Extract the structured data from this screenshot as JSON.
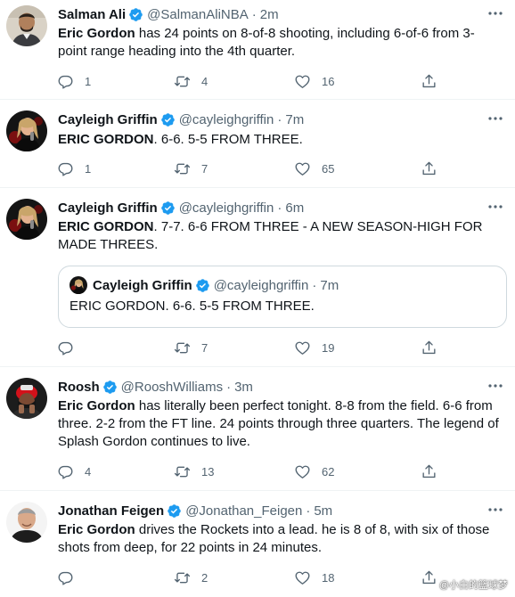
{
  "tweets": [
    {
      "name": "Salman Ali",
      "handle": "@SalmanAliNBA",
      "time": "2m",
      "text_bold": "Eric Gordon",
      "text_rest": " has 24 points on 8-of-8 shooting, including 6-of-6 from 3-point range heading into the 4th quarter.",
      "replies": "1",
      "retweets": "4",
      "likes": "16"
    },
    {
      "name": "Cayleigh Griffin",
      "handle": "@cayleighgriffin",
      "time": "7m",
      "text_bold": "ERIC GORDON",
      "text_rest": ". 6-6. 5-5 FROM THREE.",
      "replies": "1",
      "retweets": "7",
      "likes": "65"
    },
    {
      "name": "Cayleigh Griffin",
      "handle": "@cayleighgriffin",
      "time": "6m",
      "text_bold": "ERIC GORDON",
      "text_rest": ". 7-7. 6-6 FROM THREE - A NEW SEASON-HIGH FOR MADE THREES.",
      "replies": "",
      "retweets": "7",
      "likes": "19",
      "quote": {
        "name": "Cayleigh Griffin",
        "handle": "@cayleighgriffin",
        "time": "7m",
        "text": "ERIC GORDON. 6-6. 5-5 FROM THREE."
      }
    },
    {
      "name": "Roosh",
      "handle": "@RooshWilliams",
      "time": "3m",
      "text_bold": "Eric Gordon",
      "text_rest": " has literally been perfect tonight. 8-8 from the field. 6-6 from three. 2-2 from the FT line. 24 points through three quarters. The legend of Splash Gordon continues to live.",
      "replies": "4",
      "retweets": "13",
      "likes": "62"
    },
    {
      "name": "Jonathan Feigen",
      "handle": "@Jonathan_Feigen",
      "time": "5m",
      "text_bold": "Eric Gordon",
      "text_rest": " drives the Rockets into a lead. he is 8 of 8, with six of those shots from deep, for 22 points in 24 minutes.",
      "replies": "",
      "retweets": "2",
      "likes": "18"
    }
  ],
  "separator": "·",
  "watermark": "@小白的篮球梦",
  "colors": {
    "text": "#0f1419",
    "secondary": "#536471",
    "verified": "#1d9bf0",
    "border": "#eff3f4"
  },
  "icons": [
    "verified-badge-icon",
    "more-icon",
    "reply-icon",
    "retweet-icon",
    "like-icon",
    "share-icon"
  ]
}
